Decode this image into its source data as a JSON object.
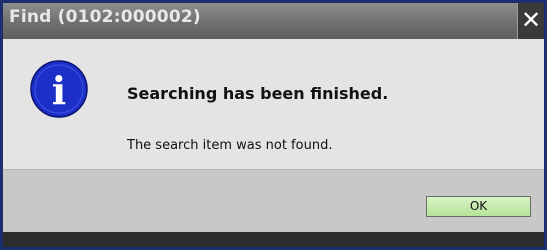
{
  "window": {
    "title": "Find (0102:000002)",
    "close_glyph": "✕"
  },
  "dialog": {
    "icon": "info-icon",
    "icon_glyph": "i",
    "heading": "Searching has been finished.",
    "message": "The search item was not found."
  },
  "buttons": {
    "ok_label": "OK"
  },
  "colors": {
    "icon_blue": "#1c30c8",
    "ok_button_green": "#b6e39a"
  }
}
